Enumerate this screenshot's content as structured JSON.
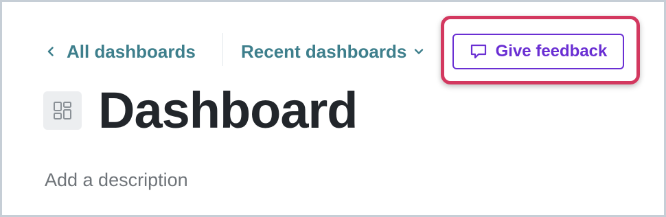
{
  "nav": {
    "back_label": "All dashboards",
    "recent_label": "Recent dashboards",
    "feedback_label": "Give feedback"
  },
  "page": {
    "title": "Dashboard",
    "description_placeholder": "Add a description"
  },
  "icons": {
    "back": "chevron-left-icon",
    "recent": "chevron-down-icon",
    "feedback": "message-icon",
    "dashboard": "dashboard-grid-icon"
  },
  "colors": {
    "link": "#3e7f8c",
    "feedback_accent": "#6a2fd3",
    "highlight": "#d3385f",
    "title": "#22262b",
    "muted_text": "#6f7479",
    "icon_bg": "#eceef0",
    "frame_border": "#c6ced6"
  }
}
